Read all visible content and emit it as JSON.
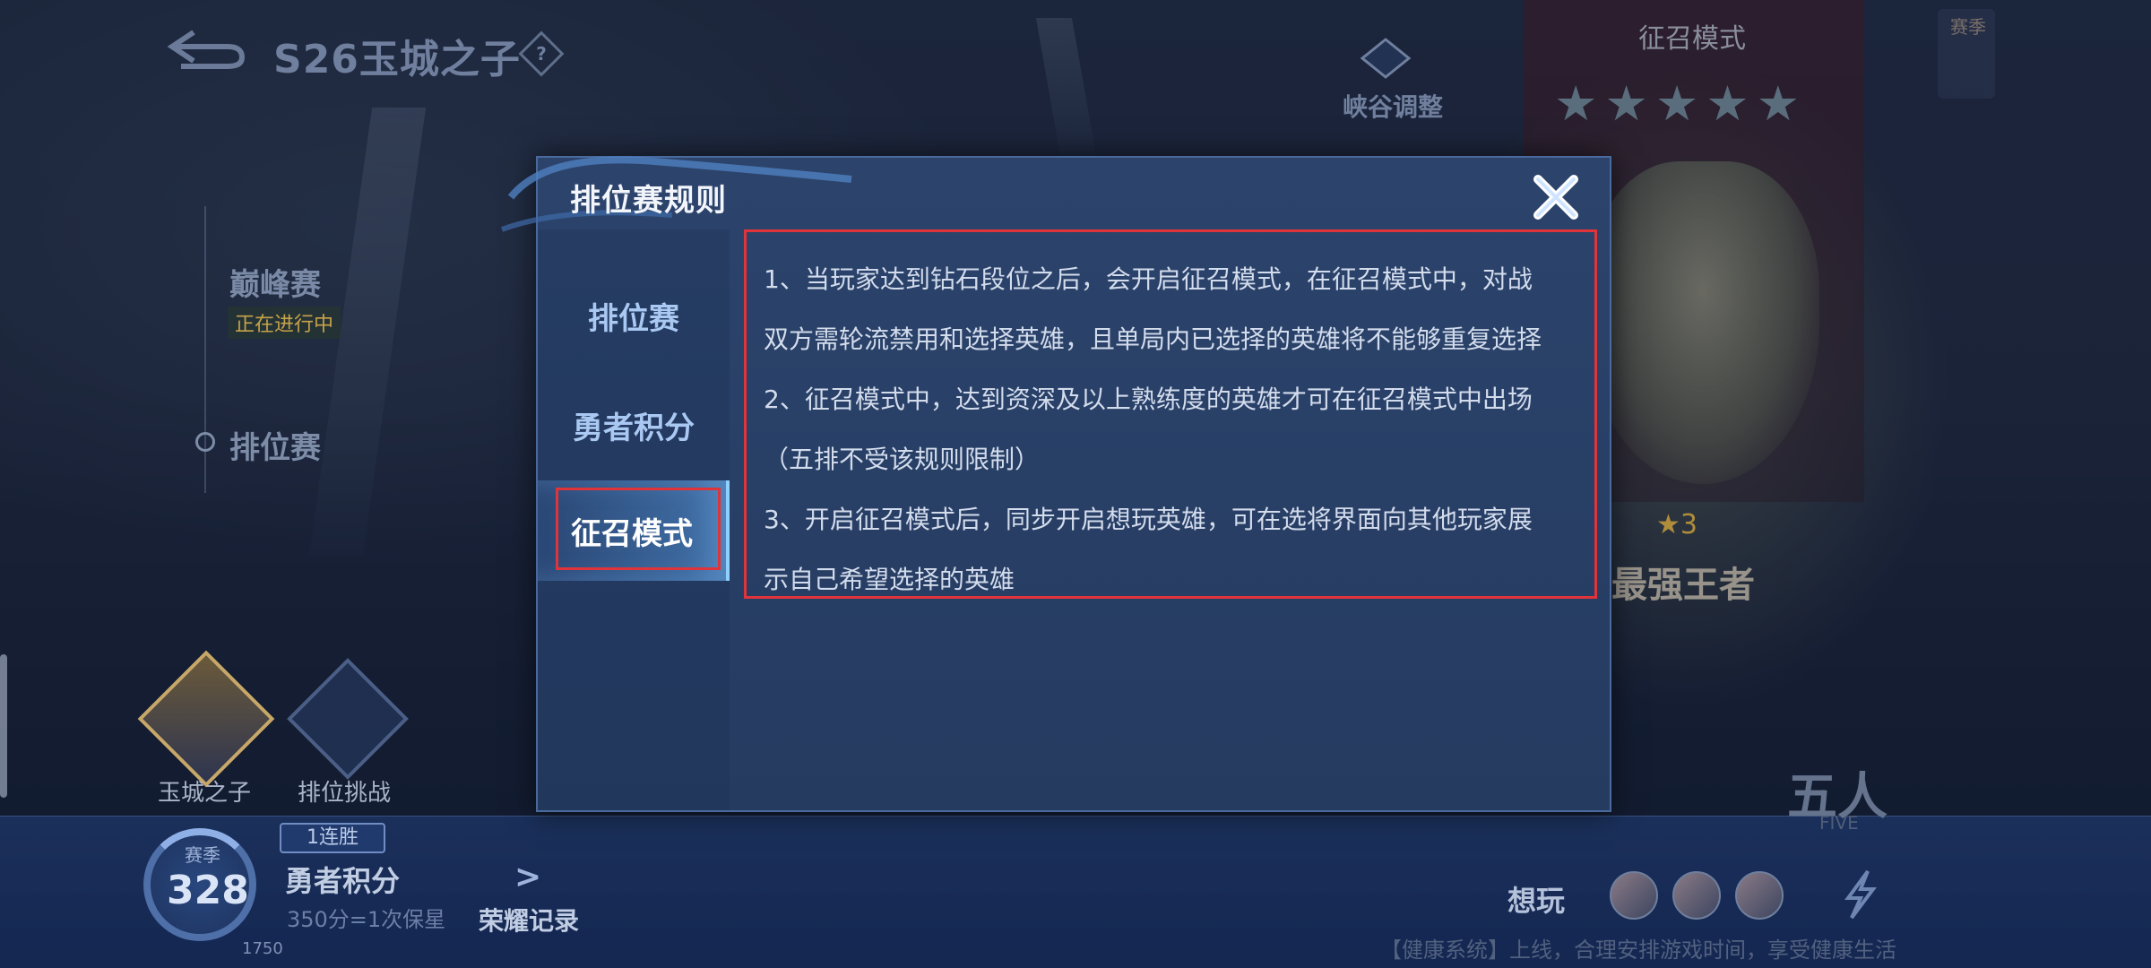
{
  "header": {
    "season_title": "S26玉城之子",
    "help_symbol": "?"
  },
  "side_menu": {
    "peak": "巅峰赛",
    "peak_status": "正在进行中",
    "ranked": "排位赛"
  },
  "profile": {
    "avatar_label": "玉城之子",
    "challenge_label": "排位挑战"
  },
  "bottom": {
    "season_label": "赛季",
    "season_value": "328",
    "season_sub": "1750",
    "streak": "1连胜",
    "brave_points": "勇者积分",
    "brave_sub": "350分=1次保星",
    "honor_record": "荣耀记录",
    "want_label": "想玩",
    "health_notice": "【健康系统】上线，合理安排游戏时间，享受健康生活"
  },
  "right": {
    "banner_title": "征召模式",
    "banner_stars": "★★★★★",
    "season_badge": "赛季",
    "king_stars": "★3",
    "king_title": "最强王者",
    "canyon": "峡谷调整",
    "five": "五人",
    "five_sub": "FIVE"
  },
  "modal": {
    "title": "排位赛规则",
    "tabs": [
      {
        "label": "排位赛"
      },
      {
        "label": "勇者积分"
      },
      {
        "label": "征召模式"
      }
    ],
    "active_tab": "征召模式",
    "rules": [
      "1、当玩家达到钻石段位之后，会开启征召模式，在征召模式中，对战",
      "双方需轮流禁用和选择英雄，且单局内已选择的英雄将不能够重复选择",
      "2、征召模式中，达到资深及以上熟练度的英雄才可在征召模式中出场",
      "（五排不受该规则限制）",
      "3、开启征召模式后，同步开启想玩英雄，可在选将界面向其他玩家展",
      "示自己希望选择的英雄"
    ]
  },
  "colors": {
    "accent": "#8fd0ff",
    "annotation": "#e0343a",
    "modal_bg": "#2c446c"
  }
}
